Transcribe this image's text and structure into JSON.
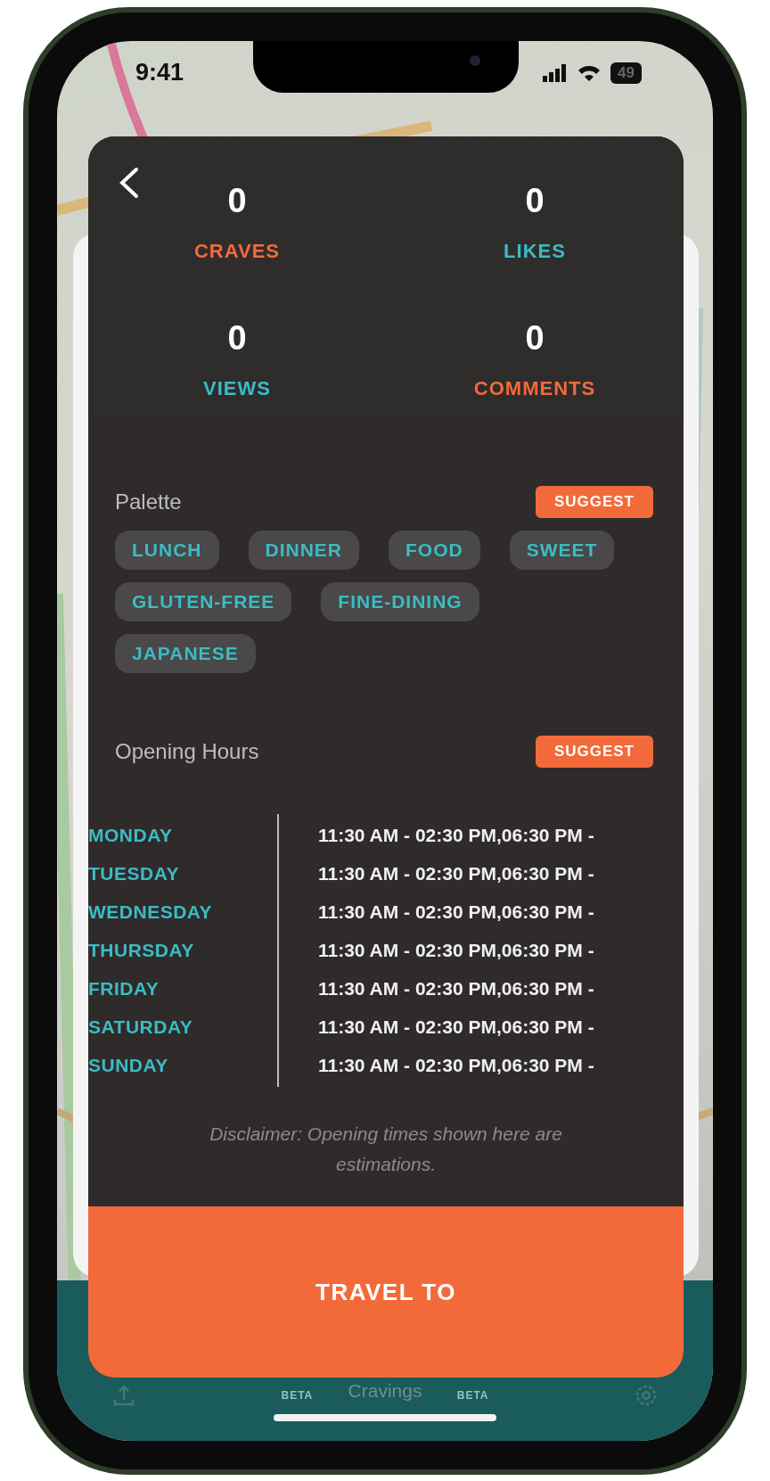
{
  "status_bar": {
    "time": "9:41",
    "battery": "49"
  },
  "stats": [
    {
      "value": "0",
      "label": "CRAVES",
      "color": "#f26a3a"
    },
    {
      "value": "0",
      "label": "LIKES",
      "color": "#3bbcc4"
    },
    {
      "value": "0",
      "label": "VIEWS",
      "color": "#3bbcc4"
    },
    {
      "value": "0",
      "label": "COMMENTS",
      "color": "#f26a3a"
    }
  ],
  "palette": {
    "title": "Palette",
    "suggest_button": "SUGGEST",
    "tags": [
      "LUNCH",
      "DINNER",
      "FOOD",
      "SWEET",
      "GLUTEN-FREE",
      "FINE-DINING",
      "JAPANESE"
    ]
  },
  "opening_hours": {
    "title": "Opening Hours",
    "suggest_button": "SUGGEST",
    "days": [
      {
        "day": "MONDAY",
        "hours": "11:30 AM - 02:30 PM,06:30 PM -"
      },
      {
        "day": "TUESDAY",
        "hours": "11:30 AM - 02:30 PM,06:30 PM -"
      },
      {
        "day": "WEDNESDAY",
        "hours": "11:30 AM - 02:30 PM,06:30 PM -"
      },
      {
        "day": "THURSDAY",
        "hours": "11:30 AM - 02:30 PM,06:30 PM -"
      },
      {
        "day": "FRIDAY",
        "hours": "11:30 AM - 02:30 PM,06:30 PM -"
      },
      {
        "day": "SATURDAY",
        "hours": "11:30 AM - 02:30 PM,06:30 PM -"
      },
      {
        "day": "SUNDAY",
        "hours": "11:30 AM - 02:30 PM,06:30 PM -"
      }
    ],
    "disclaimer": "Disclaimer: Opening times shown here are estimations."
  },
  "travel_button": "TRAVEL TO",
  "tab_bar": {
    "beta_badges": [
      "BETA",
      "BETA"
    ],
    "label": "Cravings"
  }
}
